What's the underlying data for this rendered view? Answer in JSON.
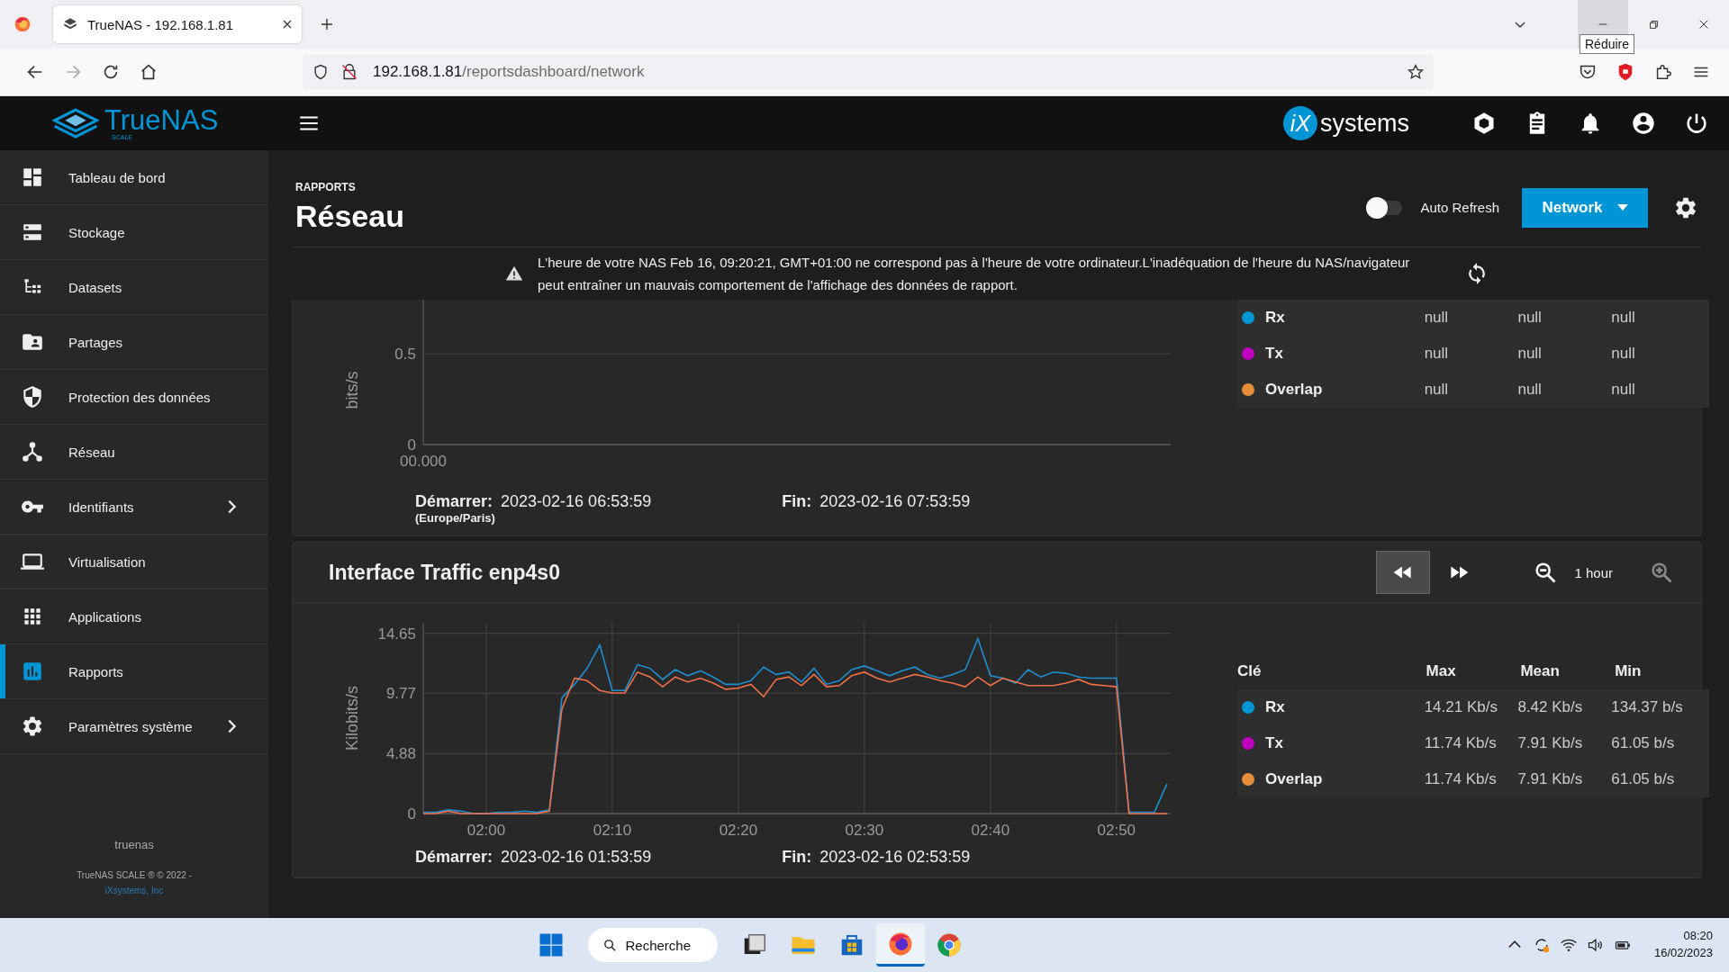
{
  "browser": {
    "tab_title": "TrueNAS - 192.168.1.81",
    "url_host": "192.168.1.81",
    "url_path": "/reportsdashboard/network",
    "tooltip": "Réduire"
  },
  "topbar": {
    "logo": "TrueNAS",
    "logo_sub": "SCALE",
    "vendor_mark": "iX",
    "vendor_name": "systems"
  },
  "sidebar": {
    "items": [
      {
        "label": "Tableau de bord",
        "selected": false,
        "has_submenu": false
      },
      {
        "label": "Stockage",
        "selected": false,
        "has_submenu": false
      },
      {
        "label": "Datasets",
        "selected": false,
        "has_submenu": false
      },
      {
        "label": "Partages",
        "selected": false,
        "has_submenu": false
      },
      {
        "label": "Protection des données",
        "selected": false,
        "has_submenu": false
      },
      {
        "label": "Réseau",
        "selected": false,
        "has_submenu": false
      },
      {
        "label": "Identifiants",
        "selected": false,
        "has_submenu": true
      },
      {
        "label": "Virtualisation",
        "selected": false,
        "has_submenu": false
      },
      {
        "label": "Applications",
        "selected": false,
        "has_submenu": false
      },
      {
        "label": "Rapports",
        "selected": true,
        "has_submenu": false
      },
      {
        "label": "Paramètres système",
        "selected": false,
        "has_submenu": true
      }
    ],
    "hostname": "truenas",
    "copyright": "TrueNAS SCALE ® © 2022 -",
    "company_link": "iXsystems, Inc"
  },
  "page": {
    "breadcrumb": "RAPPORTS",
    "title": "Réseau",
    "auto_refresh": {
      "label": "Auto Refresh",
      "on": false
    },
    "menu_button": "Network"
  },
  "alert": {
    "text": "L'heure de votre NAS Feb 16, 09:20:21, GMT+01:00 ne correspond pas à l'heure de votre ordinateur.L'inadéquation de l'heure du NAS/navigateur peut entraîner un mauvais comportement de l'affichage des données de rapport."
  },
  "cards": [
    {
      "legend": {
        "rows": [
          {
            "name": "Rx",
            "color": "#0095d5",
            "values": [
              "null",
              "null",
              "null"
            ]
          },
          {
            "name": "Tx",
            "color": "#c000c0",
            "values": [
              "null",
              "null",
              "null"
            ]
          },
          {
            "name": "Overlap",
            "color": "#e68d3a",
            "values": [
              "null",
              "null",
              "null"
            ]
          }
        ]
      },
      "empty_chart": {
        "ylabel": "bits/s",
        "ytick_labels": [
          "0.5",
          "0"
        ],
        "xtick_label": "00.000"
      },
      "start_label": "Démarrer:",
      "start": "2023-02-16 06:53:59",
      "timezone": "(Europe/Paris)",
      "end_label": "Fin:",
      "end": "2023-02-16 07:53:59"
    },
    {
      "title": "Interface Traffic enp4s0",
      "controls": {
        "back_pressed": true,
        "zoom_label": "1 hour"
      },
      "legend": {
        "headers": [
          "Clé",
          "Max",
          "Mean",
          "Min"
        ],
        "rows": [
          {
            "kind": "series",
            "color": "#0095d5",
            "values": [
              "14.21 Kb/s",
              "8.42 Kb/s",
              "134.37 b/s"
            ]
          },
          {
            "kind": "series",
            "color": "#c000c0",
            "values": [
              "11.74 Kb/s",
              "7.91 Kb/s",
              "61.05 b/s"
            ]
          },
          {
            "name": "Overlap",
            "color": "#e68d3a",
            "values": [
              "11.74 Kb/s",
              "7.91 Kb/s",
              "61.05 b/s"
            ]
          }
        ]
      },
      "chart_data": {
        "type": "line",
        "ylabel": "Kilobits/s",
        "grid": true,
        "ylim": [
          0,
          15.5
        ],
        "yticks": [
          0,
          4.88,
          9.77,
          14.65
        ],
        "xlim": [
          115,
          174.3
        ],
        "xticks": [
          {
            "value": 120,
            "label": "02:00"
          },
          {
            "value": 130,
            "label": "02:10"
          },
          {
            "value": 140,
            "label": "02:20"
          },
          {
            "value": 150,
            "label": "02:30"
          },
          {
            "value": 160,
            "label": "02:40"
          },
          {
            "value": 170,
            "label": "02:50"
          }
        ],
        "x": [
          115,
          116,
          117,
          118,
          119,
          120,
          121,
          122,
          123,
          124,
          125,
          126,
          127,
          128,
          129,
          130,
          131,
          132,
          133,
          134,
          135,
          136,
          137,
          138,
          139,
          140,
          141,
          142,
          143,
          144,
          145,
          146,
          147,
          148,
          149,
          150,
          151,
          152,
          153,
          154,
          155,
          156,
          157,
          158,
          159,
          160,
          161,
          162,
          163,
          164,
          165,
          166,
          167,
          168,
          169,
          170,
          171,
          172,
          173,
          174
        ],
        "series": [
          {
            "name": "Rx",
            "color": "#1f8fd0",
            "values": [
              0.1,
              0.1,
              0.3,
              0.2,
              0.0,
              0.0,
              0.1,
              0.1,
              0.2,
              0.1,
              0.3,
              9.4,
              10.5,
              11.8,
              13.7,
              10.0,
              10.0,
              12.1,
              11.8,
              10.9,
              11.7,
              11.2,
              11.6,
              11.1,
              10.5,
              10.5,
              10.8,
              11.9,
              11.3,
              11.5,
              10.7,
              11.8,
              10.5,
              10.8,
              11.7,
              12.0,
              11.6,
              11.2,
              11.6,
              11.9,
              11.3,
              11.0,
              11.3,
              11.7,
              14.2,
              11.2,
              11.0,
              10.6,
              11.7,
              11.1,
              11.5,
              11.4,
              11.1,
              11.0,
              11.0,
              11.0,
              0.1,
              0.1,
              0.1,
              2.4
            ]
          },
          {
            "name": "Tx",
            "color": "#f0704a",
            "values": [
              0.0,
              0.0,
              0.2,
              0.0,
              0.0,
              0.0,
              0.0,
              0.0,
              0.0,
              0.0,
              0.2,
              8.5,
              11.0,
              10.8,
              10.0,
              9.8,
              9.8,
              11.5,
              11.1,
              10.3,
              11.1,
              10.7,
              11.0,
              10.6,
              10.1,
              10.2,
              10.5,
              9.5,
              10.9,
              11.1,
              10.4,
              11.3,
              10.3,
              10.4,
              11.2,
              11.5,
              11.0,
              10.7,
              11.0,
              11.3,
              11.1,
              10.8,
              10.6,
              10.3,
              11.1,
              10.4,
              11.0,
              10.7,
              10.4,
              10.4,
              10.4,
              10.6,
              10.9,
              10.5,
              10.4,
              10.3,
              0.0,
              0.0,
              0.0,
              0.0
            ]
          }
        ]
      },
      "start_label": "Démarrer:",
      "start": "2023-02-16 01:53:59",
      "end_label": "Fin:",
      "end": "2023-02-16 02:53:59"
    }
  ],
  "taskbar": {
    "search": "Recherche",
    "time": "08:20",
    "date": "16/02/2023"
  }
}
